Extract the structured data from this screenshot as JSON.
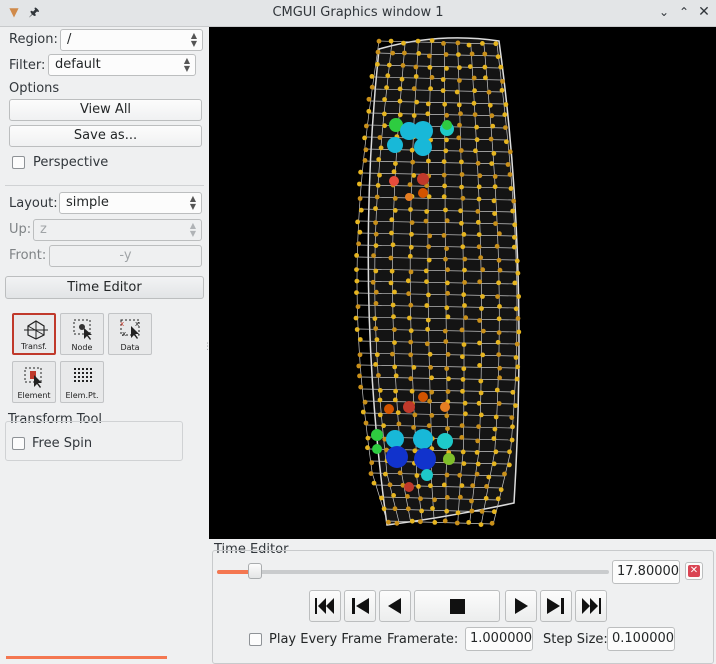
{
  "window": {
    "title": "CMGUI Graphics window 1"
  },
  "region": {
    "label": "Region:",
    "value": "/"
  },
  "filter": {
    "label": "Filter:",
    "value": "default"
  },
  "options": {
    "title": "Options",
    "view_all": "View All",
    "save_as": "Save as...",
    "perspective": "Perspective",
    "perspective_checked": false
  },
  "layout": {
    "label": "Layout:",
    "value": "simple",
    "up_label": "Up:",
    "up_value": "z",
    "front_label": "Front:",
    "front_value": "-y"
  },
  "time_editor_button": "Time Editor",
  "tools": [
    {
      "label": "Transf.",
      "icon": "transform-icon",
      "active": true
    },
    {
      "label": "Node",
      "icon": "node-select-icon",
      "active": false
    },
    {
      "label": "Data",
      "icon": "data-select-icon",
      "active": false
    },
    {
      "label": "Element",
      "icon": "element-select-icon",
      "active": false
    },
    {
      "label": "Elem.Pt.",
      "icon": "element-point-icon",
      "active": false
    }
  ],
  "transform_tool": {
    "title": "Transform Tool",
    "free_spin": "Free Spin",
    "free_spin_checked": false
  },
  "time_editor": {
    "title": "Time Editor",
    "time_value": "17.800000",
    "slider_fraction": 0.178,
    "play_every_frame": "Play Every Frame",
    "framerate_label": "Framerate:",
    "framerate": "1.000000",
    "step_label": "Step Size:",
    "step": "0.100000",
    "controls": [
      "fast-backward-icon",
      "step-backward-icon",
      "play-backward-icon",
      "stop-icon",
      "play-forward-icon",
      "step-forward-icon",
      "fast-forward-icon"
    ]
  },
  "colors": {
    "accent": "#f47751",
    "close_red": "#da4453"
  }
}
